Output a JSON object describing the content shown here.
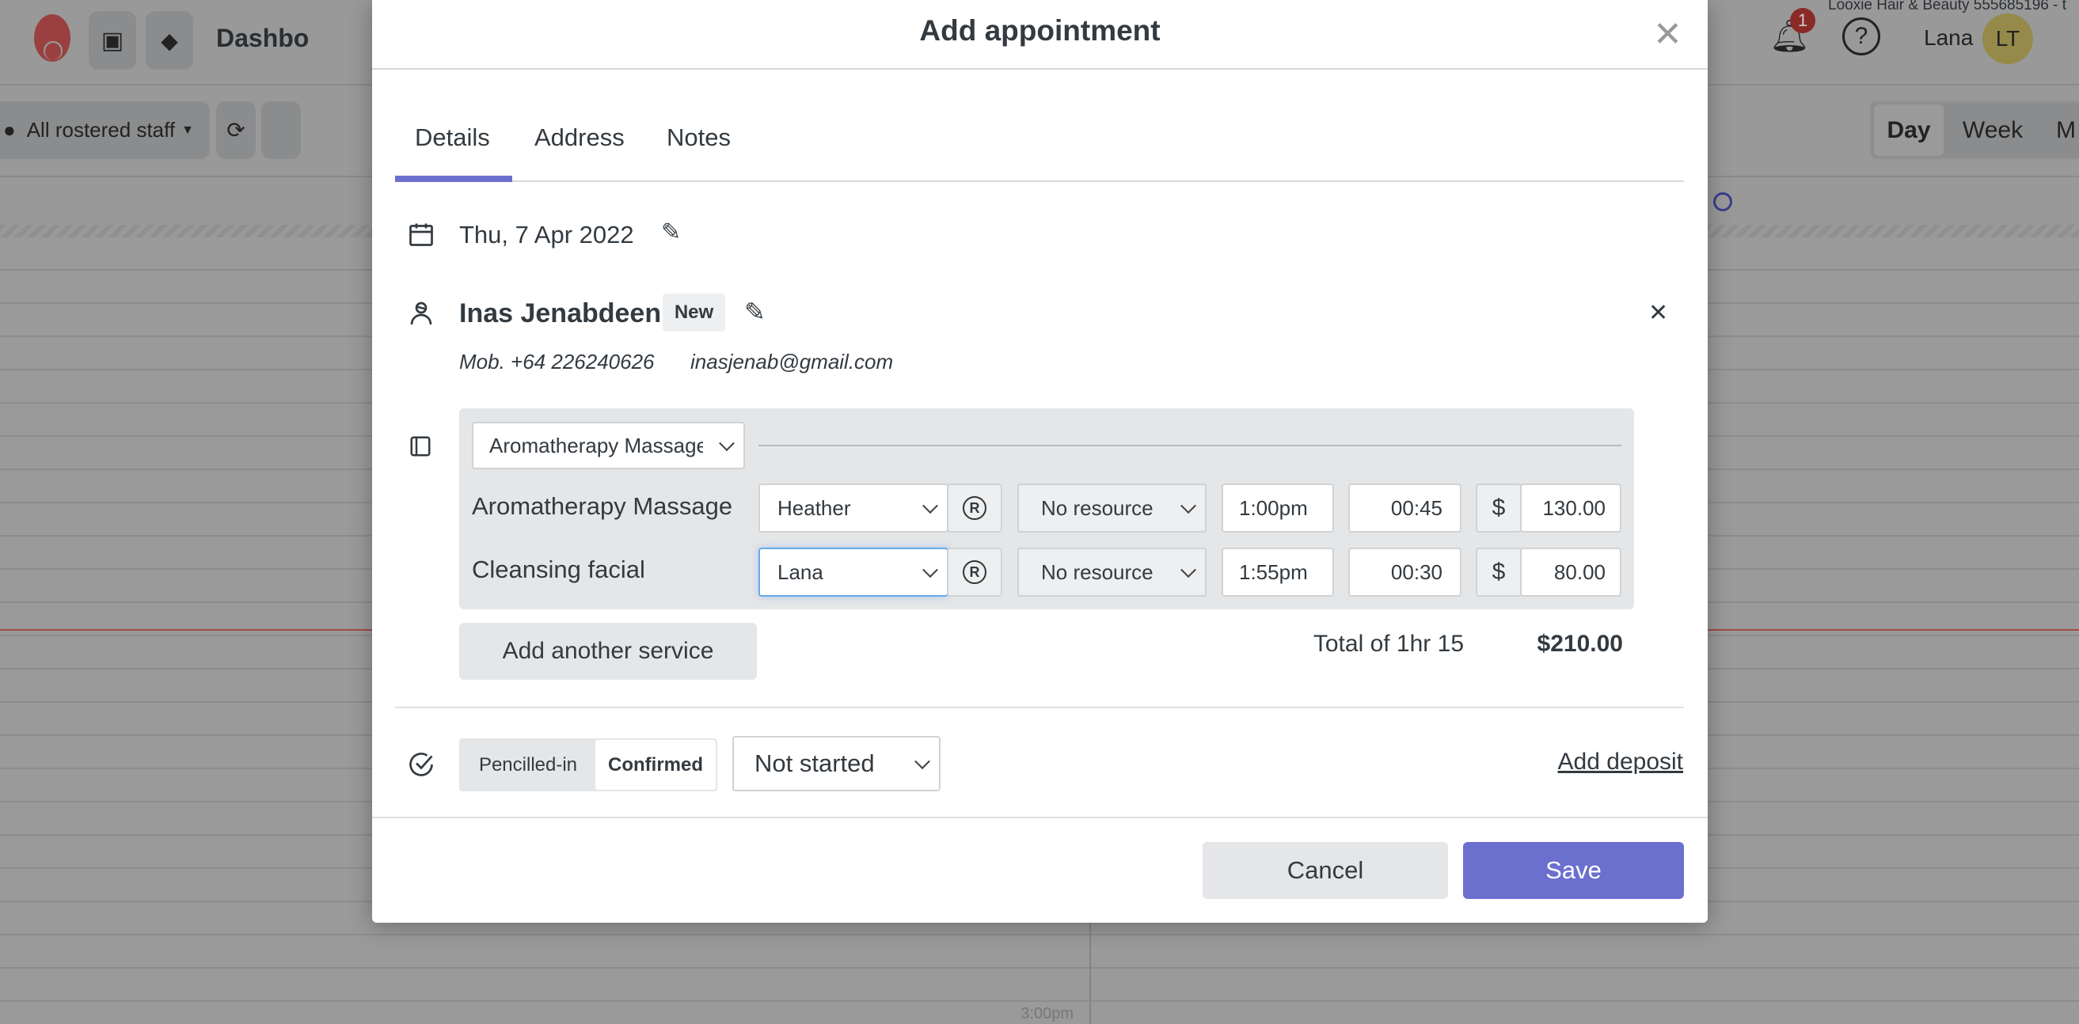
{
  "background": {
    "topbar": {
      "title": "Dashbo",
      "business": "Looxie Hair & Beauty 555685196 - t",
      "notification_count": "1",
      "user_name": "Lana",
      "user_initials": "LT"
    },
    "toolbar": {
      "staff_filter": "All rostered staff",
      "views": [
        "Day",
        "Week",
        "M"
      ]
    },
    "calendar": {
      "time_label": "3:00pm"
    },
    "colors": {
      "logo": "#9b4040",
      "badge": "#8a2a27",
      "avatar": "#958a4a"
    }
  },
  "modal": {
    "title": "Add appointment",
    "tabs": [
      {
        "label": "Details",
        "active": true
      },
      {
        "label": "Address"
      },
      {
        "label": "Notes"
      }
    ],
    "date": "Thu, 7 Apr 2022",
    "client": {
      "name": "Inas Jenabdeen",
      "badge": "New",
      "mobile": "Mob. +64 226240626",
      "email": "inasjenab@gmail.com"
    },
    "package": "Aromatherapy Massage",
    "services": [
      {
        "name": "Aromatherapy Massage",
        "staff": "Heather",
        "resource": "No resource",
        "time": "1:00pm",
        "duration": "00:45",
        "currency": "$",
        "price": "130.00"
      },
      {
        "name": "Cleansing facial",
        "staff": "Lana",
        "resource": "No resource",
        "time": "1:55pm",
        "duration": "00:30",
        "currency": "$",
        "price": "80.00"
      }
    ],
    "add_service_label": "Add another service",
    "total_label": "Total of 1hr 15",
    "total_amount": "$210.00",
    "status_options": [
      "Pencilled-in",
      "Confirmed"
    ],
    "status_selected": "Confirmed",
    "progress": "Not started",
    "add_deposit": "Add deposit",
    "cancel_label": "Cancel",
    "save_label": "Save",
    "accent": "#6b70cf"
  }
}
